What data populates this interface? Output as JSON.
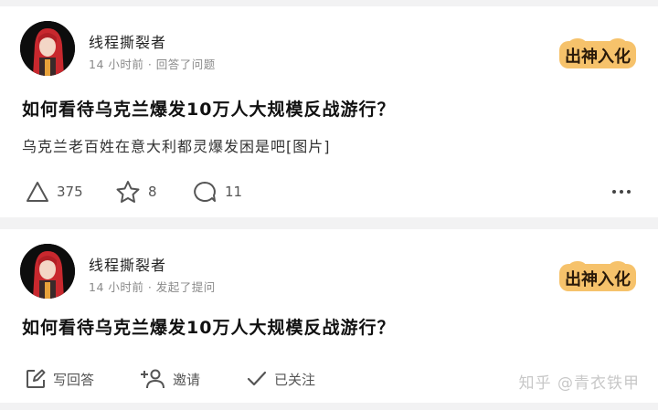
{
  "cards": [
    {
      "author": "线程撕裂者",
      "meta": "14 小时前 · 回答了问题",
      "badge_text": "出神入化",
      "question": "如何看待乌克兰爆发10万人大规模反战游行？",
      "excerpt": "乌克兰老百姓在意大利都灵爆发困是吧[图片]",
      "actions": {
        "upvote_count": "375",
        "favorite_count": "8",
        "comment_count": "11"
      }
    },
    {
      "author": "线程撕裂者",
      "meta": "14 小时前 · 发起了提问",
      "badge_text": "出神入化",
      "question": "如何看待乌克兰爆发10万人大规模反战游行？",
      "actions": {
        "write_answer": "写回答",
        "invite": "邀请",
        "followed": "已关注"
      }
    }
  ],
  "watermark": "知乎 @青衣铁甲",
  "colors": {
    "badge_bg": "#f6c26b",
    "badge_text": "#2a1a0a",
    "icon": "#555555",
    "avatar_hair": "#c8282e"
  }
}
